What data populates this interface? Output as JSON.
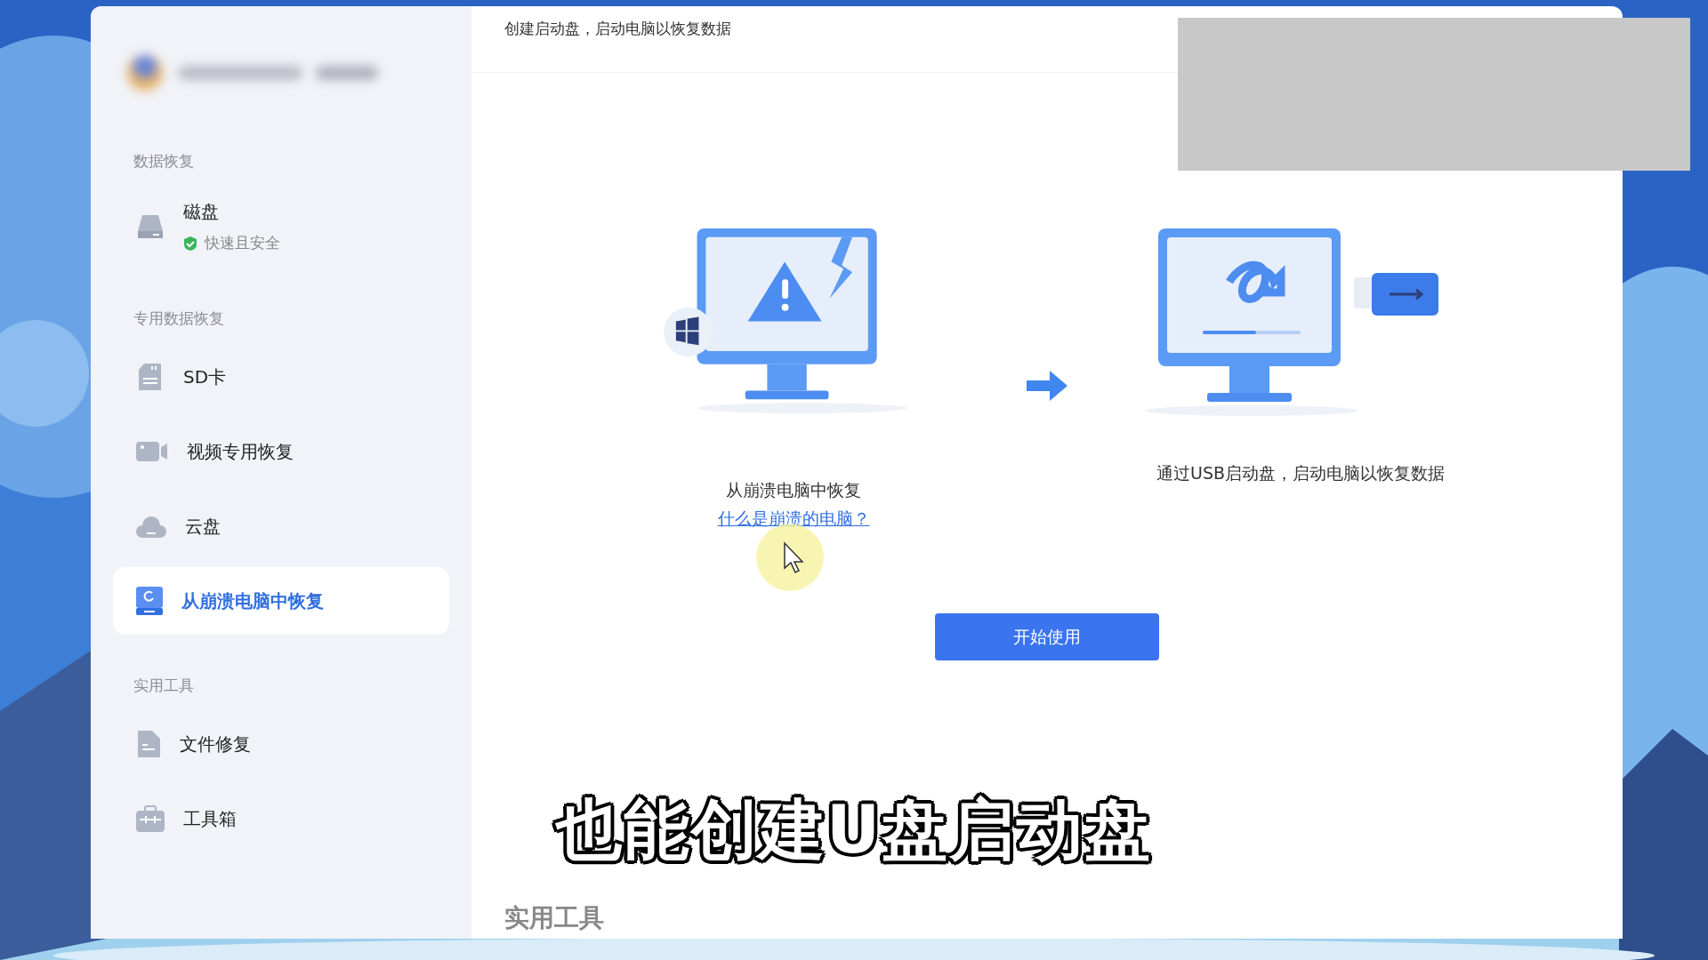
{
  "sidebar": {
    "sections": [
      {
        "title": "数据恢复",
        "items": [
          {
            "label": "磁盘",
            "badge": "快速且安全",
            "selected": false
          }
        ]
      },
      {
        "title": "专用数据恢复",
        "items": [
          {
            "label": "SD卡",
            "selected": false
          },
          {
            "label": "视频专用恢复",
            "selected": false
          },
          {
            "label": "云盘",
            "selected": false
          },
          {
            "label": "从崩溃电脑中恢复",
            "selected": true
          }
        ]
      },
      {
        "title": "实用工具",
        "items": [
          {
            "label": "文件修复",
            "selected": false
          },
          {
            "label": "工具箱",
            "selected": false
          }
        ]
      }
    ]
  },
  "main": {
    "header": "创建启动盘，启动电脑以恢复数据",
    "steps": [
      {
        "caption": "从崩溃电脑中恢复",
        "link": "什么是崩溃的电脑？"
      },
      {
        "caption": "通过USB启动盘，启动电脑以恢复数据"
      }
    ],
    "button": "开始使用",
    "section_heading": "实用工具"
  },
  "video_caption": "也能创建U盘启动盘"
}
